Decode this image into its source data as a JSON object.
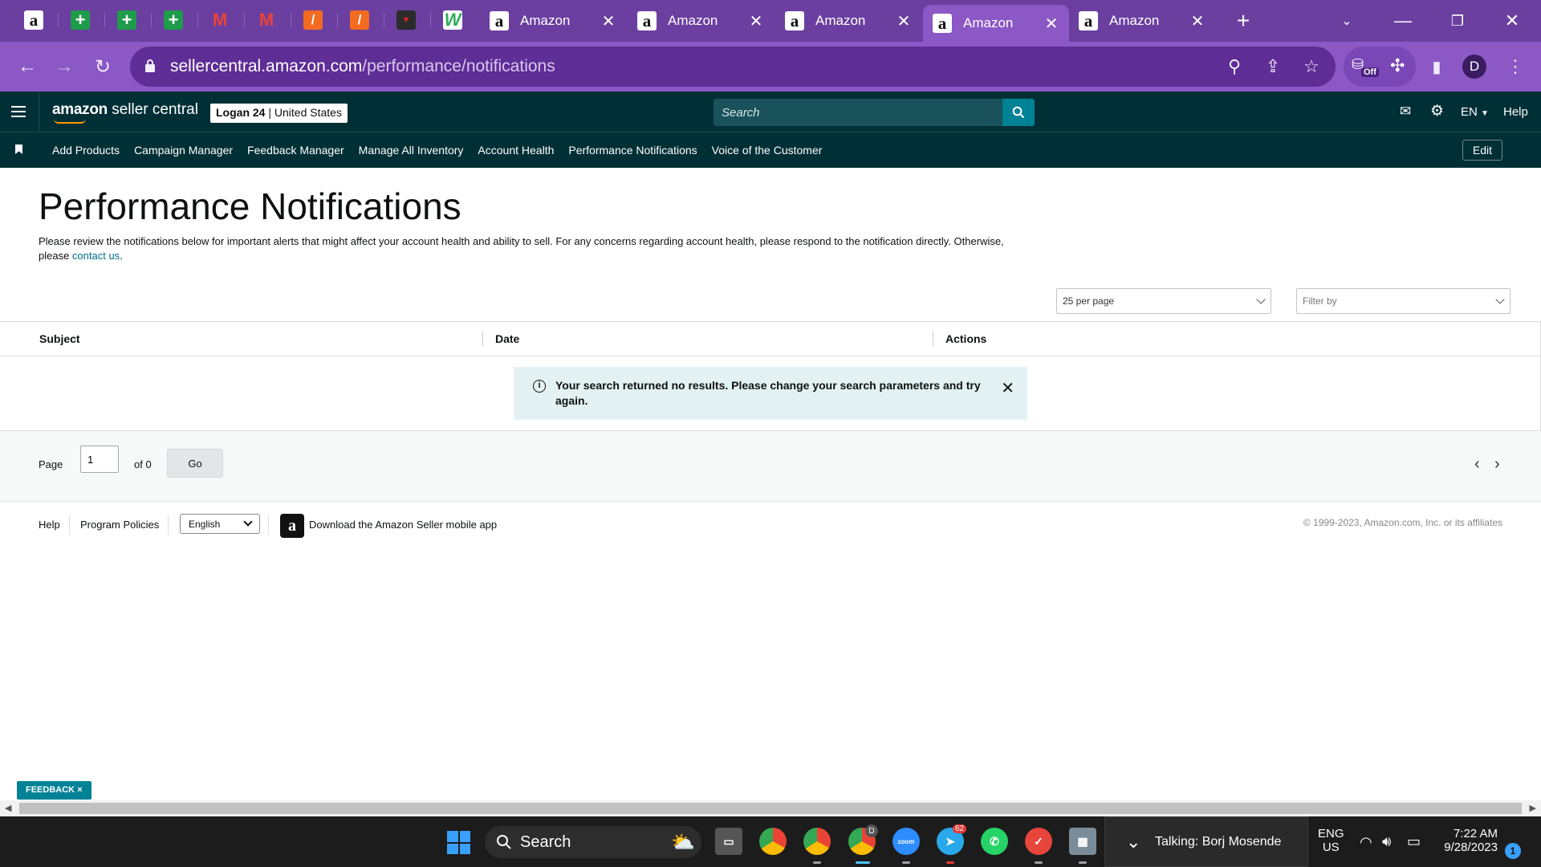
{
  "browser": {
    "tabs": [
      {
        "title": "Amazon"
      },
      {
        "title": "Amazon"
      },
      {
        "title": "Amazon"
      },
      {
        "title": "Amazon",
        "active": true
      },
      {
        "title": "Amazon"
      }
    ],
    "pinned_icons": [
      "amazon-icon",
      "google-sheets-icon",
      "google-sheets-icon",
      "google-sheets-icon",
      "gmail-icon",
      "gmail-icon",
      "slack-like-icon",
      "slack-like-icon",
      "red-logo-icon",
      "w-app-icon"
    ],
    "url_host": "sellercentral.amazon.com",
    "url_path": "/performance/notifications",
    "extension_badge": "Off",
    "profile_initial": "D"
  },
  "header": {
    "logo_brand": "amazon",
    "logo_product": "seller central",
    "account_name": "Logan 24",
    "account_sep": " | ",
    "account_region": "United States",
    "search_placeholder": "Search",
    "language": "EN",
    "help": "Help"
  },
  "nav": {
    "items": [
      "Add Products",
      "Campaign Manager",
      "Feedback Manager",
      "Manage All Inventory",
      "Account Health",
      "Performance Notifications",
      "Voice of the Customer"
    ],
    "edit_label": "Edit"
  },
  "main": {
    "title": "Performance Notifications",
    "intro": "Please review the notifications below for important alerts that might affect your account health and ability to sell. For any concerns regarding account health, please respond to the notification directly. Otherwise, please ",
    "contact_link": "contact us",
    "intro_end": ".",
    "per_page": "25 per page",
    "filter_placeholder": "Filter by",
    "columns": [
      "Subject",
      "Date",
      "Actions"
    ],
    "alert_text": "Your search returned no results. Please change your search parameters and try again.",
    "pager": {
      "page_label": "Page",
      "page_value": "1",
      "of_label": "of 0",
      "go_label": "Go"
    }
  },
  "footer": {
    "help": "Help",
    "program_policies": "Program Policies",
    "language": "English",
    "app_download": "Download the Amazon Seller mobile app",
    "copyright": "© 1999-2023, Amazon.com, Inc. or its affiliates"
  },
  "feedback": {
    "label": "FEEDBACK",
    "close": "×"
  },
  "taskbar": {
    "search_label": "Search",
    "talking": "Talking: Borj Mosende",
    "lang_top": "ENG",
    "lang_bottom": "US",
    "time": "7:22 AM",
    "date": "9/28/2023",
    "telegram_badge": "62",
    "notification_count": "1",
    "profile_badge": "D",
    "zoom_label": "zoom"
  }
}
